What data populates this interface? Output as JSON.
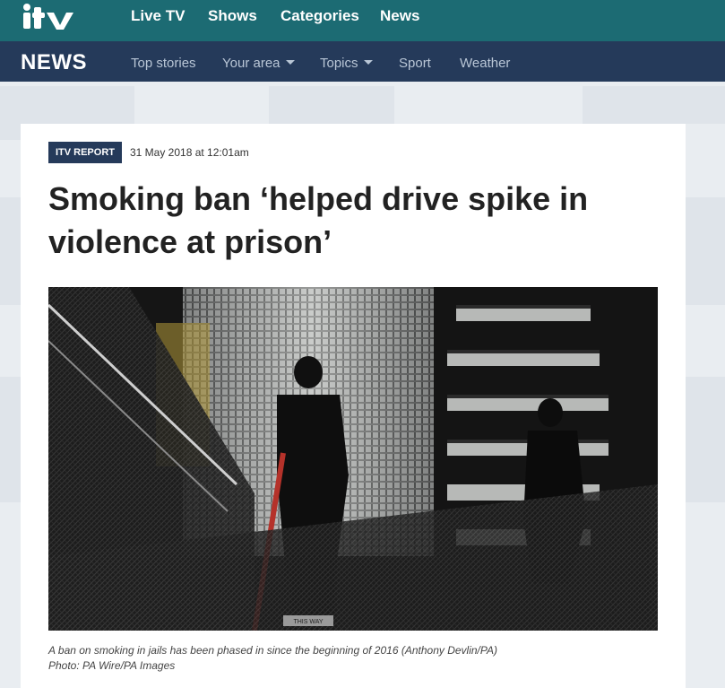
{
  "brand": {
    "logo_text": "itv"
  },
  "top_nav": [
    "Live TV",
    "Shows",
    "Categories",
    "News"
  ],
  "section": {
    "title": "NEWS",
    "nav": [
      {
        "label": "Top stories",
        "dropdown": false
      },
      {
        "label": "Your area",
        "dropdown": true
      },
      {
        "label": "Topics",
        "dropdown": true
      },
      {
        "label": "Sport",
        "dropdown": false
      },
      {
        "label": "Weather",
        "dropdown": false
      }
    ]
  },
  "article": {
    "badge": "ITV REPORT",
    "date": "31 May 2018 at 12:01am",
    "headline_line1": "Smoking ban ‘helped drive spike in",
    "headline_line2": "violence at prison’",
    "image_sign_text": "THIS WAY",
    "caption_line1": "A ban on smoking in jails has been phased in since the beginning of 2016 (Anthony Devlin/PA)",
    "caption_line2": "Photo: PA Wire/PA Images"
  },
  "colors": {
    "topbar": "#1c6b73",
    "newsbar": "#253a5a",
    "badge": "#253a5a"
  }
}
